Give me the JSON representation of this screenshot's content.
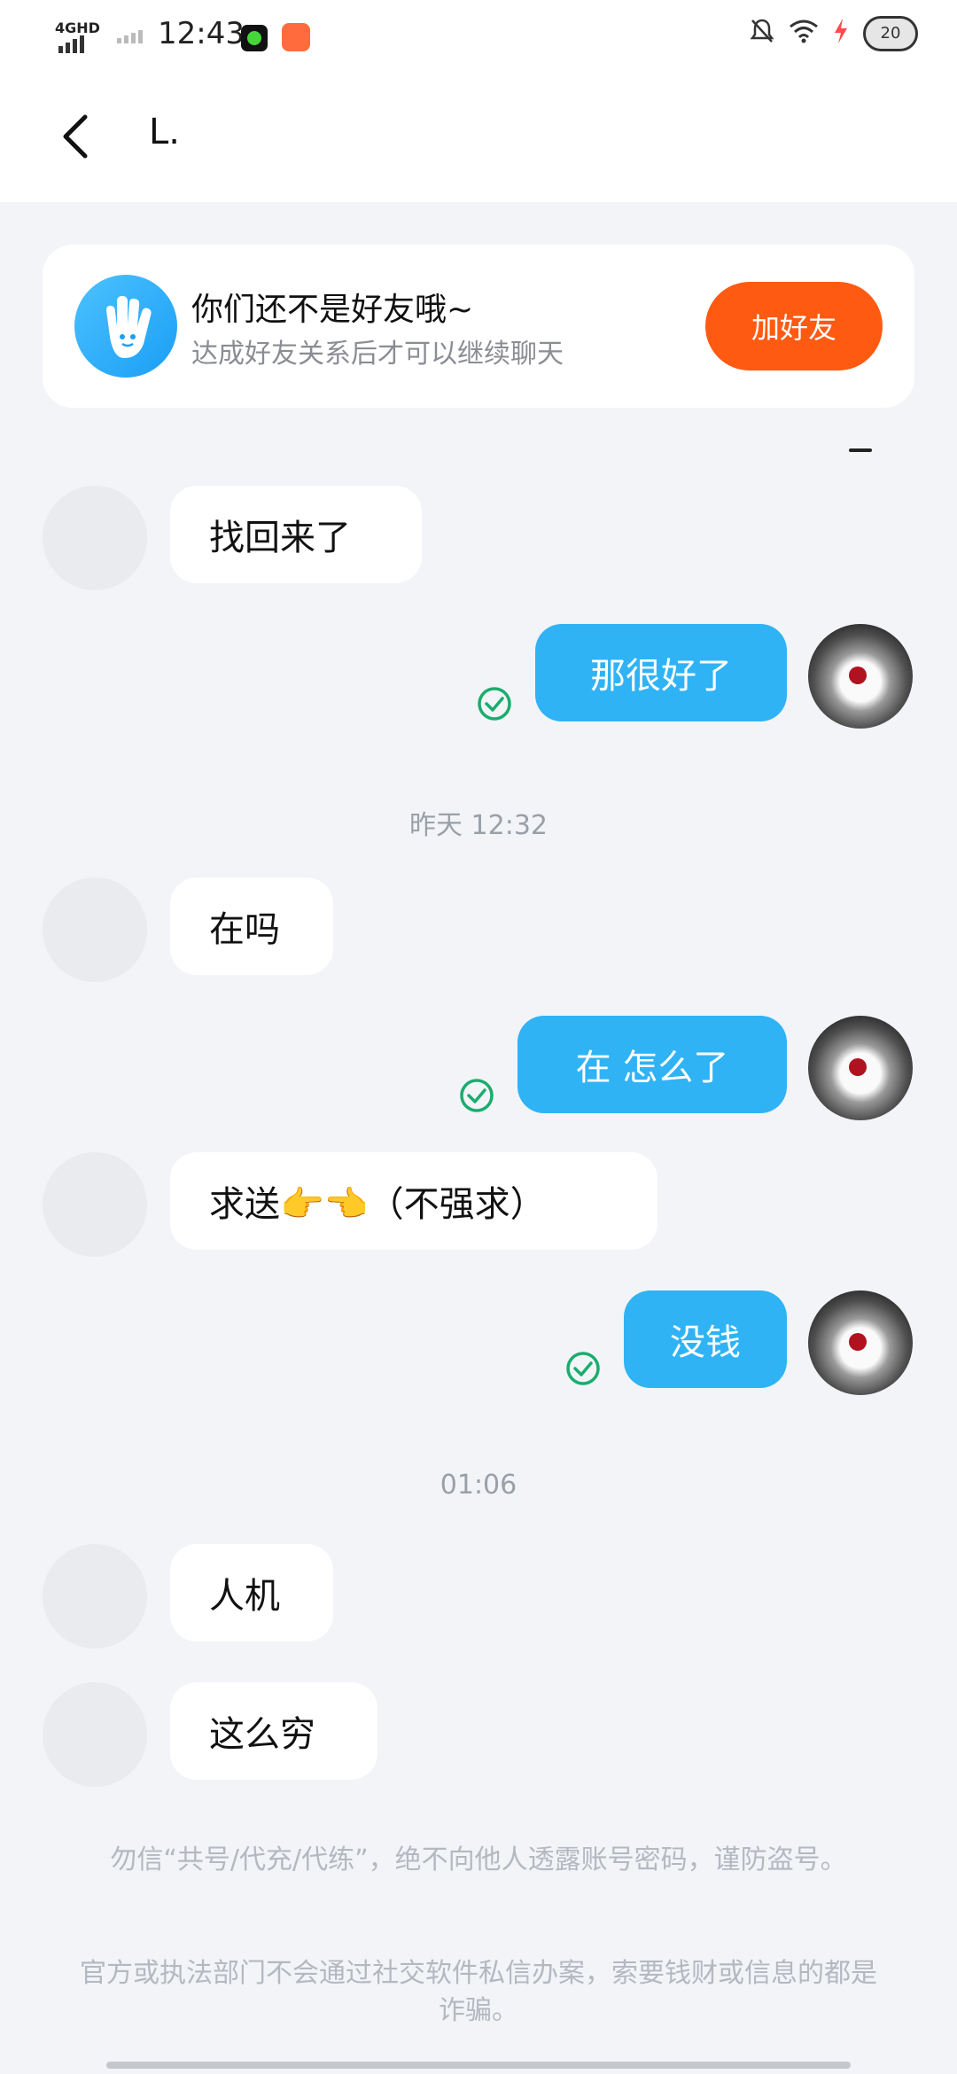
{
  "status_bar": {
    "network": "4GHD",
    "time": "12:43",
    "battery": "20",
    "icons": [
      "mute-bell-icon",
      "wifi-icon",
      "charging-icon"
    ]
  },
  "header": {
    "title": "L."
  },
  "friend_card": {
    "title": "你们还不是好友哦~",
    "subtitle": "达成好友关系后才可以继续聊天",
    "button": "加好友",
    "accent": "#ff5a12"
  },
  "messages": [
    {
      "side": "in",
      "text": "找回来了"
    },
    {
      "side": "out",
      "text": "那很好了"
    },
    {
      "type": "time",
      "text": "昨天 12:32"
    },
    {
      "side": "in",
      "text": "在吗"
    },
    {
      "side": "out",
      "text": "在 怎么了"
    },
    {
      "side": "in",
      "text": "求送👉👈（不强求）"
    },
    {
      "side": "out",
      "text": "没钱"
    },
    {
      "type": "time",
      "text": "01:06"
    },
    {
      "side": "in",
      "text": "人机"
    },
    {
      "side": "in",
      "text": "这么穷"
    }
  ],
  "notices": [
    "勿信“共号/代充/代练”，绝不向他人透露账号密码，谨防盗号。",
    "官方或执法部门不会通过社交软件私信办案，索要钱财或信息的都是诈骗。"
  ],
  "colors": {
    "bubble_out": "#2fb3f5",
    "bubble_in": "#ffffff",
    "background": "#f2f4f8",
    "read_check": "#1aad6e"
  }
}
